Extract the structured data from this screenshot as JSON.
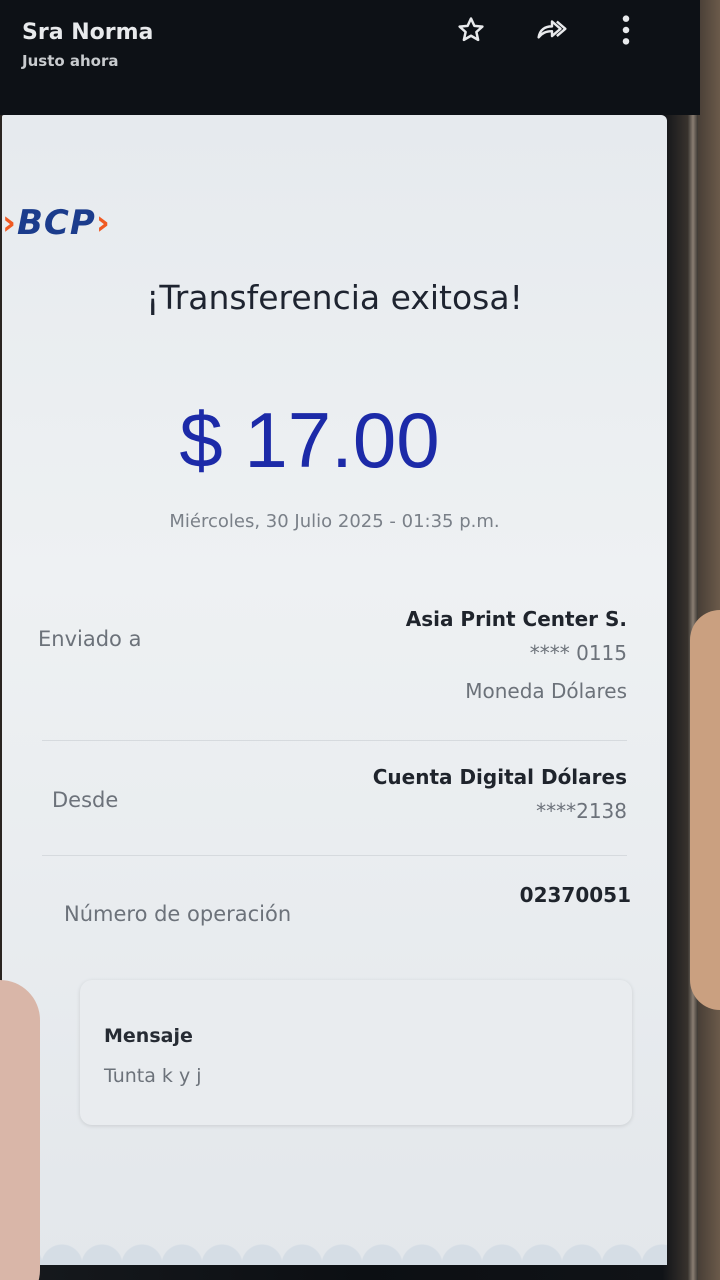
{
  "notification": {
    "sender": "Sra Norma",
    "time": "Justo ahora"
  },
  "icons": {
    "star": "star-icon",
    "forward": "forward-icon",
    "more": "more-vert-icon"
  },
  "receipt": {
    "logo": "BCP",
    "title": "¡Transferencia exitosa!",
    "amount": "$ 17.00",
    "datetime": "Miércoles, 30 Julio 2025 - 01:35 p.m.",
    "sent_to": {
      "label": "Enviado a",
      "name": "Asia Print Center S.",
      "account": "**** 0115",
      "currency": "Moneda Dólares"
    },
    "from": {
      "label": "Desde",
      "account_name": "Cuenta Digital Dólares",
      "account": "****2138"
    },
    "operation": {
      "label": "Número de operación",
      "number": "02370051"
    },
    "message": {
      "label": "Mensaje",
      "text": "Tunta k y j"
    }
  },
  "colors": {
    "brand_blue": "#1b3c8c",
    "brand_orange": "#f05a22",
    "amount_blue": "#1c2aa8"
  }
}
